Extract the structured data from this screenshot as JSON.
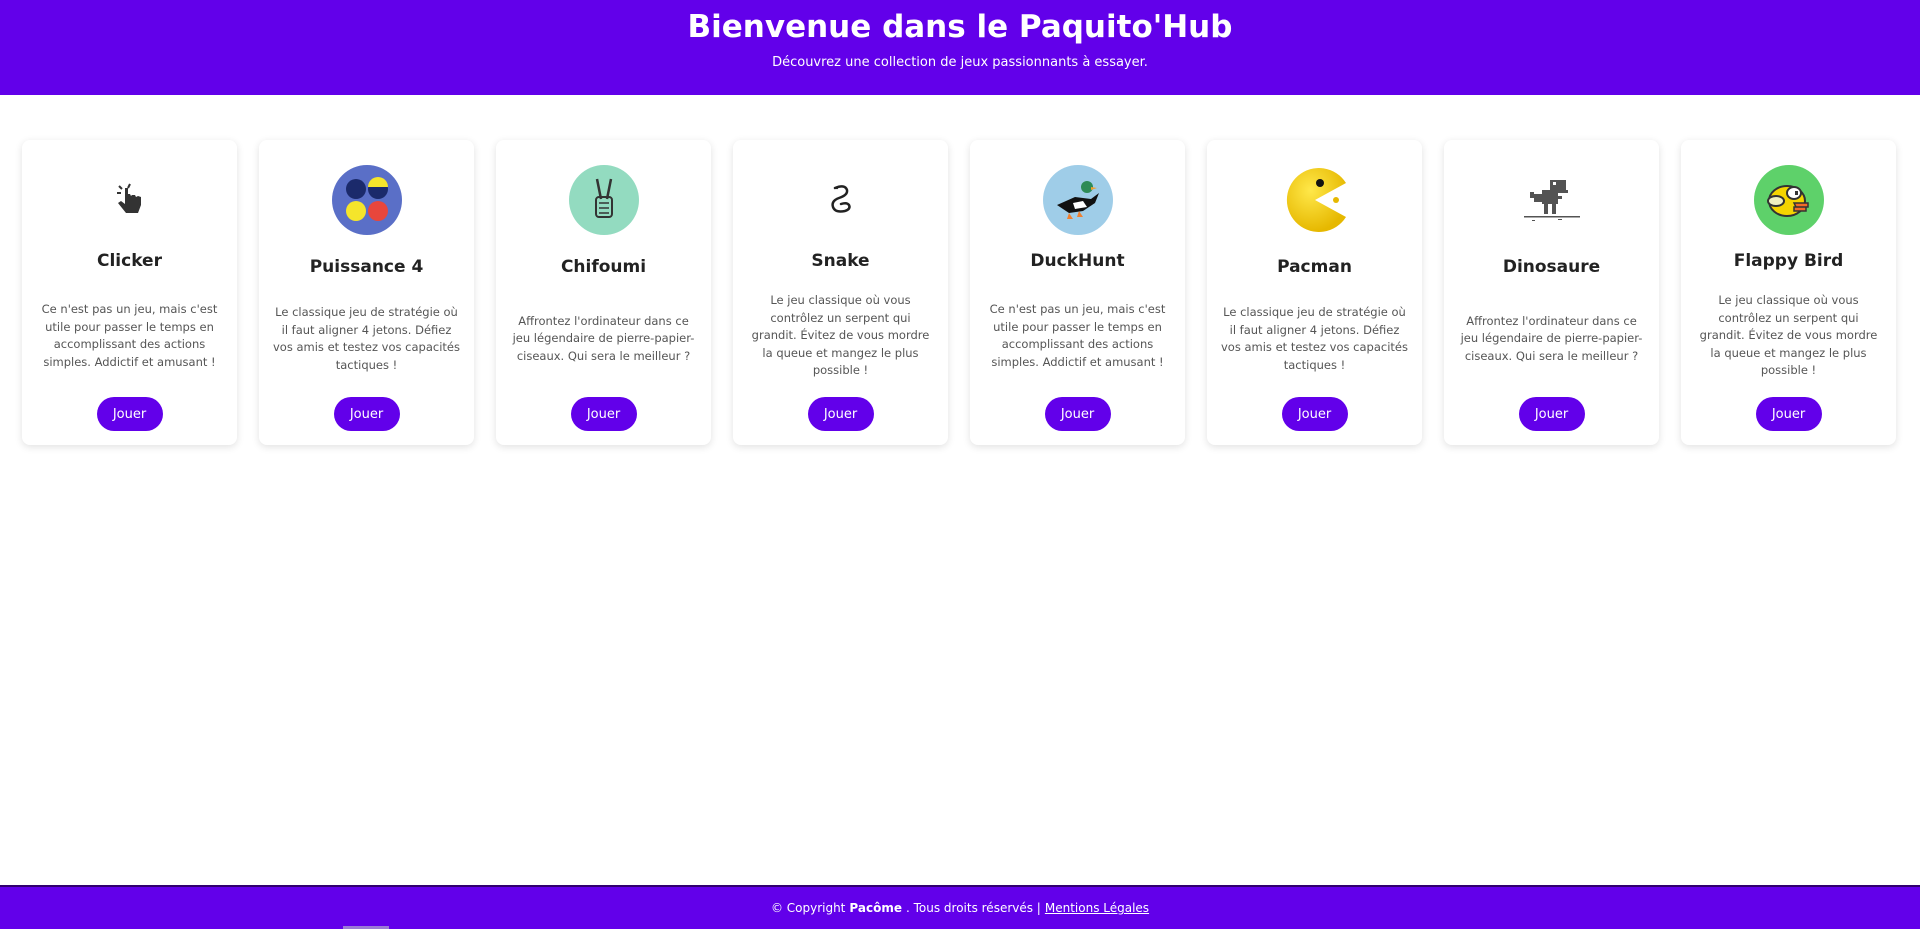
{
  "header": {
    "title": "Bienvenue dans le Paquito'Hub",
    "subtitle": "Découvrez une collection de jeux passionnants à essayer."
  },
  "games": [
    {
      "title": "Clicker",
      "icon": "pointer-hand-icon",
      "description": "Ce n'est pas un jeu, mais c'est utile pour passer le temps en accomplissant des actions simples. Addictif et amusant !",
      "button": "Jouer"
    },
    {
      "title": "Puissance 4",
      "icon": "connect-four-icon",
      "description": "Le classique jeu de stratégie où il faut aligner 4 jetons. Défiez vos amis et testez vos capacités tactiques !",
      "button": "Jouer"
    },
    {
      "title": "Chifoumi",
      "icon": "rock-paper-scissors-icon",
      "description": "Affrontez l'ordinateur dans ce jeu légendaire de pierre-papier-ciseaux. Qui sera le meilleur ?",
      "button": "Jouer"
    },
    {
      "title": "Snake",
      "icon": "snake-icon",
      "description": "Le jeu classique où vous contrôlez un serpent qui grandit. Évitez de vous mordre la queue et mangez le plus possible !",
      "button": "Jouer"
    },
    {
      "title": "DuckHunt",
      "icon": "duck-icon",
      "description": "Ce n'est pas un jeu, mais c'est utile pour passer le temps en accomplissant des actions simples. Addictif et amusant !",
      "button": "Jouer"
    },
    {
      "title": "Pacman",
      "icon": "pacman-icon",
      "description": "Le classique jeu de stratégie où il faut aligner 4 jetons. Défiez vos amis et testez vos capacités tactiques !",
      "button": "Jouer"
    },
    {
      "title": "Dinosaure",
      "icon": "dinosaur-icon",
      "description": "Affrontez l'ordinateur dans ce jeu légendaire de pierre-papier-ciseaux. Qui sera le meilleur ?",
      "button": "Jouer"
    },
    {
      "title": "Flappy Bird",
      "icon": "flappy-bird-icon",
      "description": "Le jeu classique où vous contrôlez un serpent qui grandit. Évitez de vous mordre la queue et mangez le plus possible !",
      "button": "Jouer"
    }
  ],
  "footer": {
    "copyright": "© Copyright",
    "author": "Pacôme",
    "rights": ". Tous droits réservés |",
    "legal_link": "Mentions Légales"
  },
  "colors": {
    "brand": "#6200ea",
    "background": "#ffffff"
  }
}
